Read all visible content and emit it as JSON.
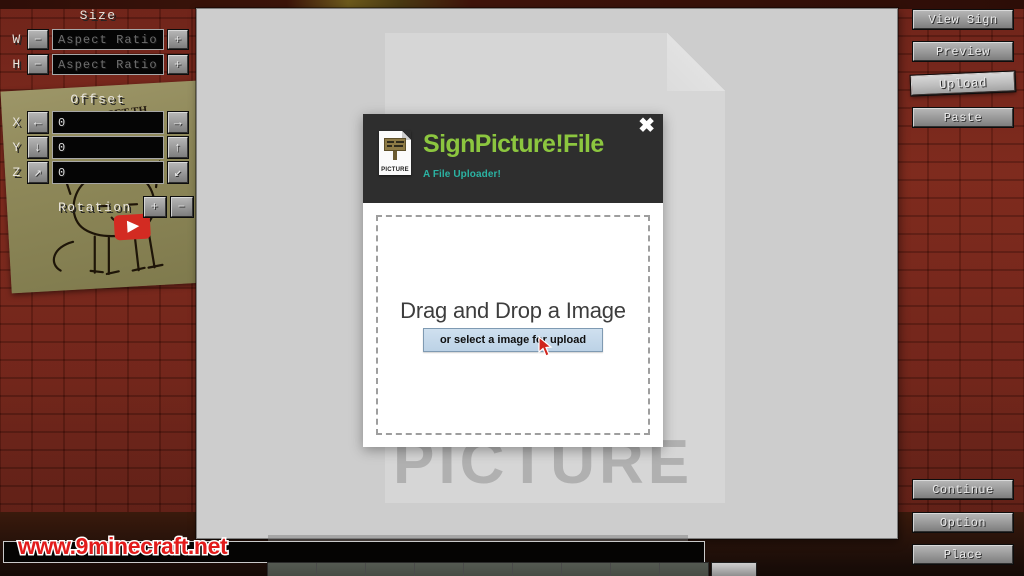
{
  "world": {
    "painting_scrawls": [
      "GET TH"
    ],
    "play_badge_icon": "youtube-play-icon"
  },
  "mod_gui": {
    "size_panel": {
      "title": "Size",
      "rows": [
        {
          "axis": "W",
          "minus": "−",
          "value": "",
          "placeholder": "Aspect Ratio",
          "plus": "+"
        },
        {
          "axis": "H",
          "minus": "−",
          "value": "",
          "placeholder": "Aspect Ratio",
          "plus": "+"
        }
      ]
    },
    "offset_panel": {
      "title": "Offset",
      "rows": [
        {
          "axis": "X",
          "left_icon": "arrow-left-icon",
          "left_glyph": "←",
          "value": "0",
          "right_icon": "arrow-right-icon",
          "right_glyph": "→"
        },
        {
          "axis": "Y",
          "left_icon": "arrow-down-icon",
          "left_glyph": "↓",
          "value": "0",
          "right_icon": "arrow-up-icon",
          "right_glyph": "↑"
        },
        {
          "axis": "Z",
          "left_icon": "arrow-up-right-icon",
          "left_glyph": "↗",
          "value": "0",
          "right_icon": "arrow-down-left-icon",
          "right_glyph": "↙"
        }
      ]
    },
    "rotation_panel": {
      "title": "Rotation",
      "plus": "+",
      "minus": "−"
    },
    "right_buttons": [
      {
        "label": "View Sign",
        "name": "view-sign-button",
        "active": false
      },
      {
        "label": "Preview",
        "name": "preview-button",
        "active": false
      },
      {
        "label": "Upload",
        "name": "upload-button",
        "active": true
      },
      {
        "label": "Paste",
        "name": "paste-button",
        "active": false
      }
    ],
    "bottom_right_buttons": [
      {
        "label": "Continue",
        "name": "continue-button"
      },
      {
        "label": "Option",
        "name": "option-button"
      },
      {
        "label": "Place",
        "name": "place-button"
      }
    ],
    "chat_input_value": ""
  },
  "browser": {
    "ghost_watermark": "PICTURE",
    "dialog": {
      "title": "SignPicture!File",
      "subtitle": "A File Uploader!",
      "icon_name": "sign-picture-file-icon",
      "icon_caption": "PICTURE",
      "close_label": "✖",
      "dropzone": {
        "heading": "Drag and Drop a Image",
        "button_label": "or select a image for upload"
      }
    }
  },
  "watermark": "www.9minecraft.net",
  "colors": {
    "brand_green": "#8cc63f",
    "brand_teal": "#2bb3a3",
    "dialog_header": "#2e2e2e",
    "watermark_red": "#e21b1b",
    "wall_red": "#7a2416"
  }
}
